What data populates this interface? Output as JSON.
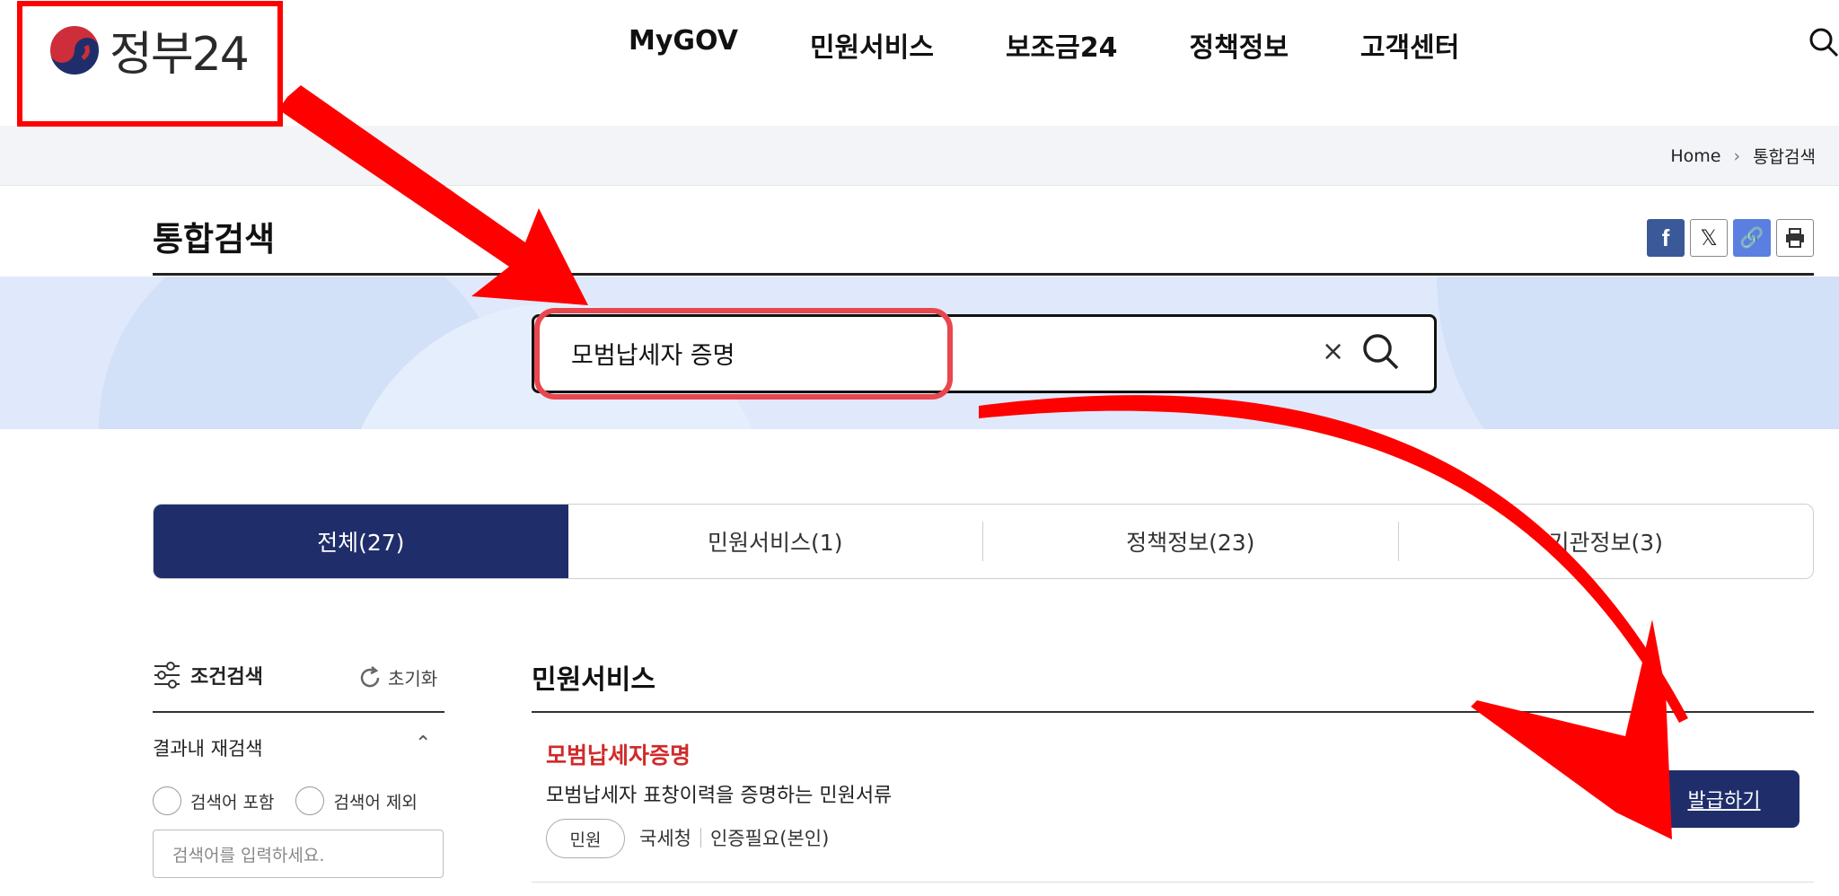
{
  "header": {
    "logo_text": "정부24",
    "nav": [
      "MyGOV",
      "민원서비스",
      "보조금24",
      "정책정보",
      "고객센터"
    ]
  },
  "breadcrumb": {
    "home": "Home",
    "current": "통합검색"
  },
  "page_title": "통합검색",
  "search": {
    "value": "모범납세자 증명",
    "clear_glyph": "×"
  },
  "tabs": [
    "전체(27)",
    "민원서비스(1)",
    "정책정보(23)",
    "기관정보(3)"
  ],
  "filter": {
    "title": "조건검색",
    "reset": "초기화",
    "refine_label": "결과내 재검색",
    "include": "검색어 포함",
    "exclude": "검색어 제외",
    "placeholder": "검색어를 입력하세요."
  },
  "results": {
    "section_title": "민원서비스",
    "item": {
      "title": "모범납세자증명",
      "desc": "모범납세자 표창이력을 증명하는 민원서류",
      "badge": "민원",
      "agency": "국세청",
      "auth": "인증필요(본인)",
      "button": "발급하기"
    }
  },
  "colors": {
    "navy": "#1f2e6b",
    "annotation_red": "#ff0000",
    "result_title_red": "#d12a2a"
  }
}
